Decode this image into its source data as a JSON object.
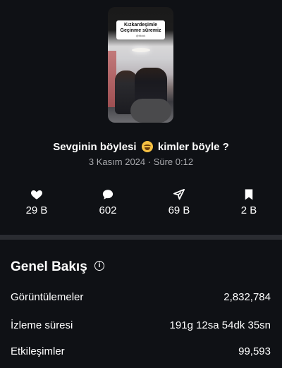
{
  "video": {
    "thumbnail": {
      "caption_lines": [
        "Kızkardeşimle",
        "Geçinme süremiz"
      ],
      "caption_sub": "@tiktok"
    },
    "title_before": "Sevginin böylesi",
    "title_emoji": "grinning-sweat-emoji",
    "title_after": "kimler böyle ?",
    "meta": "3 Kasım 2024 · Süre 0:12"
  },
  "stats": {
    "likes": {
      "icon": "heart-icon",
      "value": "29 B"
    },
    "comments": {
      "icon": "comment-icon",
      "value": "602"
    },
    "shares": {
      "icon": "share-arrow-icon",
      "value": "69 B"
    },
    "saves": {
      "icon": "bookmark-icon",
      "value": "2 B"
    }
  },
  "overview": {
    "title": "Genel Bakış",
    "info_icon": "info-icon",
    "rows": [
      {
        "label": "Görüntülemeler",
        "value": "2,832,784"
      },
      {
        "label": "İzleme süresi",
        "value": "191g 12sa 54dk 35sn"
      },
      {
        "label": "Etkileşimler",
        "value": "99,593"
      }
    ]
  },
  "colors": {
    "background": "#0f1115",
    "divider": "#2a2c31",
    "text_primary": "#ffffff",
    "text_secondary": "#a8a9ad"
  }
}
